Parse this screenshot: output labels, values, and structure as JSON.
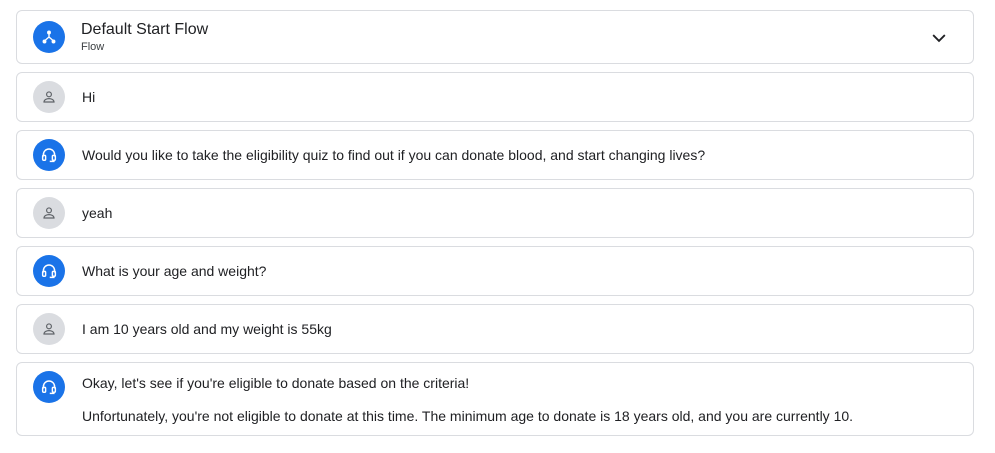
{
  "flow": {
    "title": "Default Start Flow",
    "subtitle": "Flow",
    "icon": "flow-icon",
    "expand_icon": "chevron-down-icon"
  },
  "messages": [
    {
      "role": "user",
      "icon": "person-icon",
      "text": "Hi"
    },
    {
      "role": "agent",
      "icon": "headset-icon",
      "text": "Would you like to take the eligibility quiz to find out if you can donate blood, and start changing lives?"
    },
    {
      "role": "user",
      "icon": "person-icon",
      "text": "yeah"
    },
    {
      "role": "agent",
      "icon": "headset-icon",
      "text": "What is your age and weight?"
    },
    {
      "role": "user",
      "icon": "person-icon",
      "text": "I am 10 years old and my weight is 55kg"
    },
    {
      "role": "agent",
      "icon": "headset-icon",
      "text": "Okay, let's see if you're eligible to donate based on the criteria!",
      "text2": "Unfortunately, you're not eligible to donate at this time. The minimum age to donate is 18 years old, and you are currently 10."
    }
  ],
  "colors": {
    "agent_avatar": "#1a73e8",
    "user_avatar": "#dadce0",
    "border": "#dadce0"
  }
}
